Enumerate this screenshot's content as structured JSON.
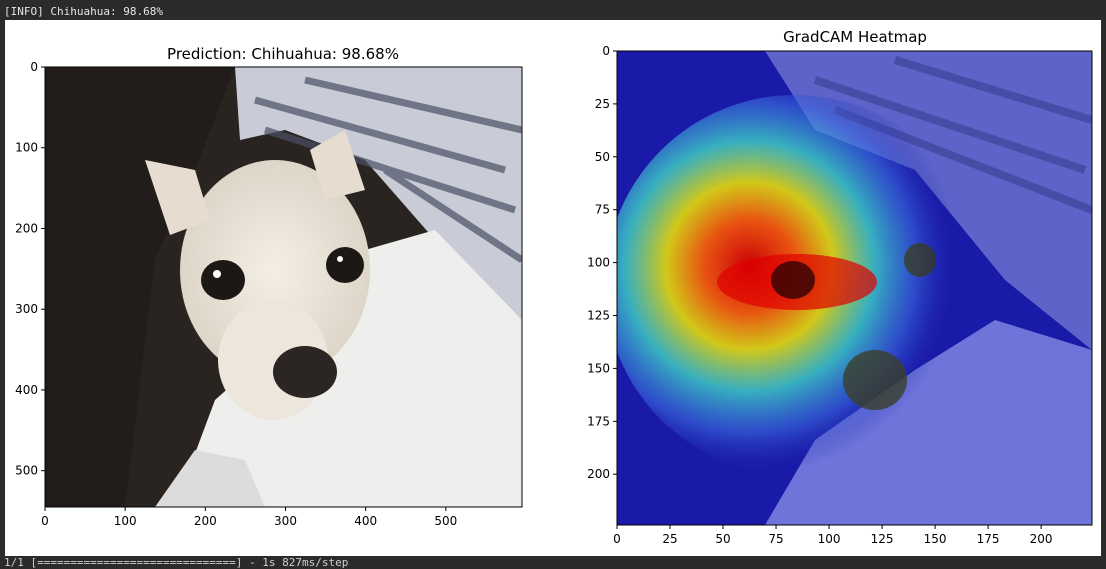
{
  "console": {
    "top_line": "[INFO] Chihuahua: 98.68%",
    "bottom_line": "1/1 [==============================] - 1s 827ms/step"
  },
  "left_plot": {
    "title": "Prediction: Chihuahua: 98.68%",
    "x_ticks": [
      "0",
      "100",
      "200",
      "300",
      "400",
      "500"
    ],
    "y_ticks": [
      "0",
      "100",
      "200",
      "300",
      "400",
      "500"
    ],
    "image_subject": "chihuahua-photo"
  },
  "right_plot": {
    "title": "GradCAM Heatmap",
    "x_ticks": [
      "0",
      "25",
      "50",
      "75",
      "100",
      "125",
      "150",
      "175",
      "200"
    ],
    "y_ticks": [
      "0",
      "25",
      "50",
      "75",
      "100",
      "125",
      "150",
      "175",
      "200"
    ],
    "image_subject": "gradcam-heatmap-overlay",
    "colormap": "jet"
  },
  "colors": {
    "console_bg": "#2b2b2b",
    "figure_bg": "#ffffff",
    "heat_blue": "#1a1aa8",
    "heat_red": "#d40000",
    "heat_yellow": "#f2e600"
  }
}
